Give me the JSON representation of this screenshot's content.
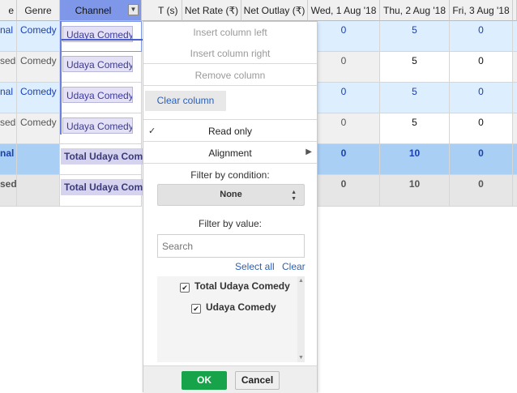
{
  "columns": {
    "partial_first": "e",
    "genre": "Genre",
    "channel": "Channel",
    "partial_t": "T (s)",
    "net_rate": "Net Rate (₹)",
    "net_outlay": "Net Outlay (₹)",
    "wed": "Wed, 1 Aug '18",
    "thu": "Thu, 2 Aug '18",
    "fri": "Fri, 3 Aug '18"
  },
  "rows": [
    {
      "a": "nal",
      "genre": "Comedy",
      "channel": "Udaya Comedy",
      "wed": "0",
      "thu": "5",
      "fri": "0"
    },
    {
      "a": "sed",
      "genre": "Comedy",
      "channel": "Udaya Comedy",
      "wed": "0",
      "thu": "5",
      "fri": "0"
    },
    {
      "a": "nal",
      "genre": "Comedy",
      "channel": "Udaya Comedy",
      "wed": "0",
      "thu": "5",
      "fri": "0"
    },
    {
      "a": "sed",
      "genre": "Comedy",
      "channel": "Udaya Comedy",
      "wed": "0",
      "thu": "5",
      "fri": "0"
    },
    {
      "a": "nal",
      "genre": "",
      "channel": "Total Udaya Come",
      "wed": "0",
      "thu": "10",
      "fri": "0"
    },
    {
      "a": "sed",
      "genre": "",
      "channel": "Total Udaya Come",
      "wed": "0",
      "thu": "10",
      "fri": "0"
    }
  ],
  "menu": {
    "insert_left": "Insert column left",
    "insert_right": "Insert column right",
    "remove_column": "Remove column",
    "clear_column": "Clear column",
    "read_only": "Read only",
    "read_only_check": "✓",
    "alignment": "Alignment",
    "alignment_arrow": "▶",
    "filter_condition_label": "Filter by condition:",
    "condition_value": "None",
    "filter_value_label": "Filter by value:",
    "search_placeholder": "Search",
    "select_all": "Select all",
    "clear": "Clear",
    "values": [
      "Total Udaya Comedy",
      "Udaya Comedy"
    ],
    "ok": "OK",
    "cancel": "Cancel"
  },
  "colors": {
    "header_selected": "#7e97e8",
    "row_highlight": "#ddeeff",
    "total_highlight": "#a9cff5",
    "ok_green": "#16a34a",
    "link_blue": "#2b5fb6"
  },
  "icons": {
    "dropdown": "chevron-down-icon",
    "submenu": "caret-right-icon",
    "check": "checkmark-icon"
  }
}
